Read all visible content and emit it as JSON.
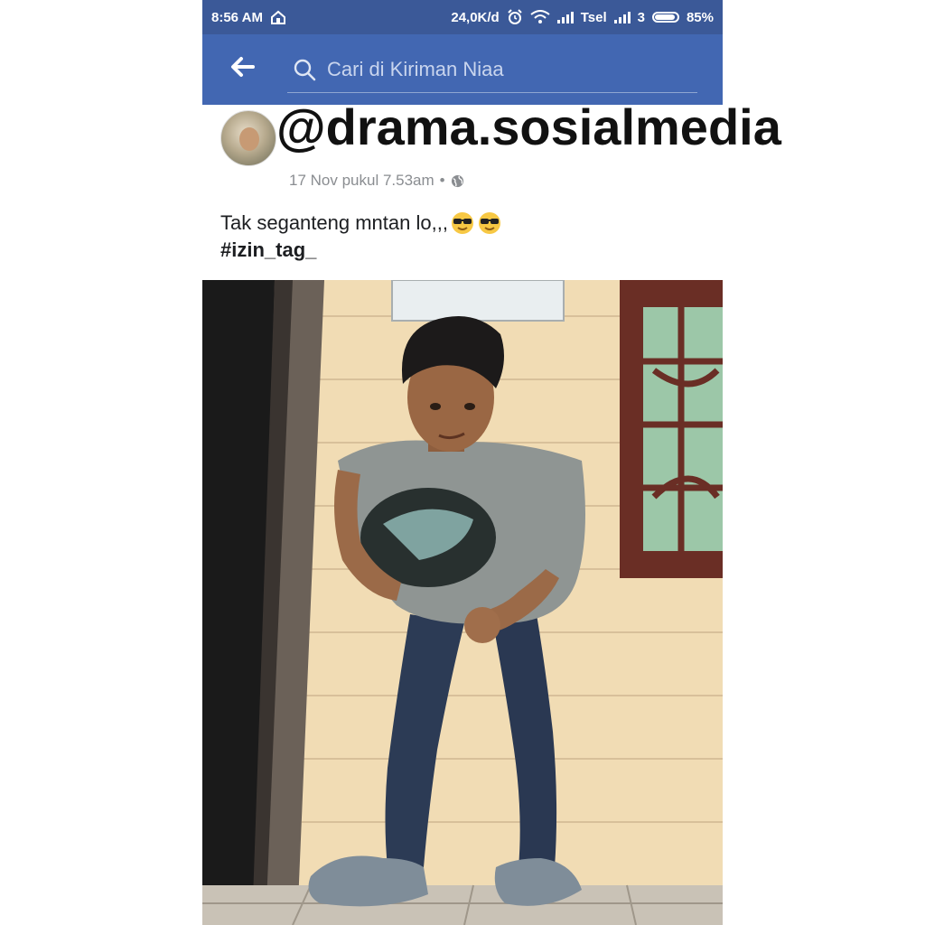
{
  "status_bar": {
    "time": "8:56 AM",
    "speed": "24,0K/d",
    "carrier": "Tsel",
    "network": "3",
    "battery": "85%",
    "battery_level": 0.85
  },
  "nav": {
    "back_icon": "arrow-left-icon",
    "search_placeholder": "Cari di Kiriman Niaa"
  },
  "post": {
    "author_name": "",
    "timestamp": "17 Nov pukul 7.53am",
    "separator": "•",
    "privacy_icon": "globe-icon",
    "caption": "Tak seganteng mntan lo,,,",
    "caption_emoji": [
      "sunglasses-emoji",
      "sunglasses-emoji"
    ],
    "hashtag": "#izin_tag_"
  },
  "watermark": "@drama.sosialmedia",
  "colors": {
    "status_bar": "#3b5998",
    "nav_bar": "#4267b2"
  }
}
